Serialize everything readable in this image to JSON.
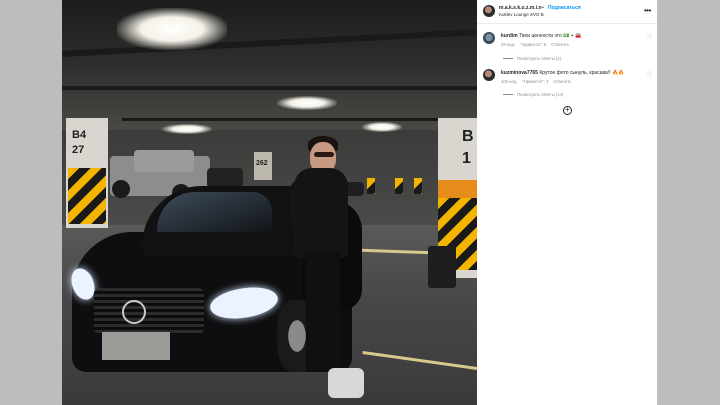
{
  "post": {
    "username": "m.a.k.s.k.u.z.m.i.n",
    "separator": "•",
    "follow_label": "Подписаться",
    "location": "Kuklev Lounge SVO B",
    "more_icon": "more-horizontal-icon"
  },
  "photo": {
    "pillar_left_label": "B4\n27",
    "pillar_right_label": "B\n1",
    "pillar_mid_label": "262"
  },
  "comments": [
    {
      "username": "kurdim",
      "text": "Твои ценности это 💵 + 🚘",
      "time": "29 нед.",
      "likes": "\"Нравится\": 8",
      "reply_label": "Ответить",
      "view_replies": "Посмотреть ответы (2)"
    },
    {
      "username": "kuzminova7765",
      "text": "Крутое фото сынуль, красава!! 🔥🔥",
      "time": "105 нед.",
      "likes": "\"Нравится\": 3",
      "reply_label": "Ответить",
      "view_replies": "Посмотреть ответы (14)"
    }
  ],
  "load_more_icon": "plus-circle-icon",
  "colors": {
    "link": "#0095f6",
    "text": "#262626",
    "muted": "#8e8e8e",
    "backdrop": "#bdbdbd"
  }
}
